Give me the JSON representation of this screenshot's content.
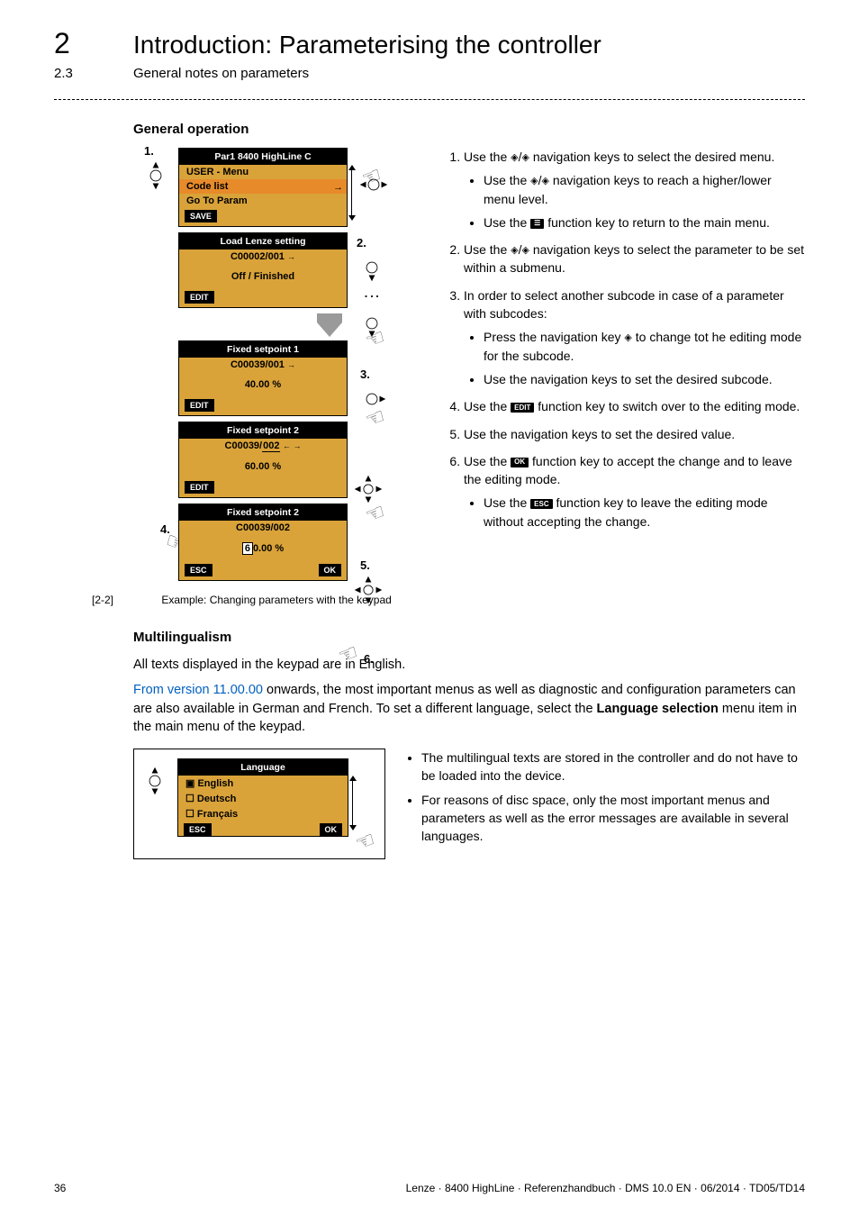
{
  "header": {
    "chapter_num": "2",
    "chapter_title": "Introduction: Parameterising the controller",
    "section_num": "2.3",
    "section_title": "General notes on parameters"
  },
  "sec1": {
    "heading": "General operation"
  },
  "proc": {
    "p1": {
      "title": "Par1 8400 HighLine C",
      "r1": "USER - Menu",
      "r2": "Code list",
      "r3": "Go To Param",
      "save": "SAVE"
    },
    "p2": {
      "title": "Load Lenze setting",
      "code": "C00002/001",
      "status": "Off / Finished",
      "edit": "EDIT"
    },
    "p3": {
      "title": "Fixed setpoint 1",
      "code": "C00039/001",
      "val": "40.00 %",
      "edit": "EDIT"
    },
    "p4": {
      "title": "Fixed setpoint 2",
      "code_pre": "C00039/",
      "code_sub": "002",
      "val": "60.00 %",
      "edit": "EDIT"
    },
    "p5": {
      "title": "Fixed setpoint 2",
      "code": "C00039/002",
      "val_pre": "6",
      "val_post": "0.00 %",
      "esc": "ESC",
      "ok": "OK"
    },
    "steps": {
      "s1": "1.",
      "s2": "2.",
      "s3": "3.",
      "s4": "4.",
      "s5": "5.",
      "s6": "6."
    }
  },
  "instructions": {
    "i1": "Use the ",
    "i1b": " navigation keys to select the desired menu.",
    "i1_s1a": "Use the ",
    "i1_s1b": " navigation keys to reach a higher/lower menu level.",
    "i1_s2a": "Use the ",
    "i1_s2b": " function key to return to the main menu.",
    "i2a": "Use the ",
    "i2b": " navigation keys to select the parameter to be set within a submenu.",
    "i3": "In order to select another subcode in case of a parameter with subcodes:",
    "i3_s1a": "Press the navigation key ",
    "i3_s1b": " to change tot he editing mode for the subcode.",
    "i3_s2": "Use the navigation keys to set the desired subcode.",
    "i4a": "Use the ",
    "i4b": " function key to switch over to the editing mode.",
    "i5": "Use the navigation keys to set the desired value.",
    "i6a": "Use the ",
    "i6b": " function key to accept the change and to leave the editing mode.",
    "i6_s1a": "Use the ",
    "i6_s1b": " function key to leave the editing mode without accepting the change."
  },
  "keys": {
    "menu": "☰",
    "edit": "EDIT",
    "ok": "OK",
    "esc": "ESC"
  },
  "glyphs": {
    "ud": "◇",
    "lr": "◇",
    "right": "◇",
    "sep": "/"
  },
  "figcap": {
    "ref": "[2-2]",
    "text": "Example: Changing parameters with the keypad"
  },
  "sec2": {
    "heading": "Multilingualism",
    "p1": "All texts displayed in the keypad are in English.",
    "p2_link": "From version 11.00.00",
    "p2_rest": " onwards, the most important menus as well as diagnostic and configuration parameters can are also available in German and French. To set a different language, select the ",
    "p2_bold": "Language selection",
    "p2_end": " menu item in the main menu of the keypad."
  },
  "lang": {
    "title": "Language",
    "o1": "English",
    "o2": "Deutsch",
    "o3": "Français",
    "esc": "ESC",
    "ok": "OK"
  },
  "lang_side": {
    "b1": "The multilingual texts are stored in the controller and do not have to be loaded into the device.",
    "b2": "For reasons of disc space, only the most important menus and parameters as well as the error messages are available in several languages."
  },
  "footer": {
    "page": "36",
    "info": "Lenze · 8400 HighLine · Referenzhandbuch · DMS 10.0 EN · 06/2014 · TD05/TD14"
  }
}
